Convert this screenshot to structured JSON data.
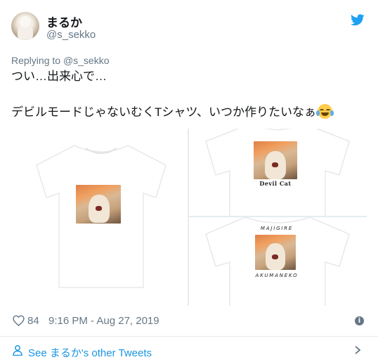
{
  "user": {
    "display_name": "まるか",
    "handle": "@s_sekko"
  },
  "reply": {
    "prefix": "Replying to",
    "mention": "@s_sekko"
  },
  "tweet": {
    "line1": "つい…出来心で…",
    "line2": "デビルモードじゃないむくTシャツ、いつか作りたいなぁ"
  },
  "media": {
    "caption_devil": "Devil Cat",
    "caption_top": "MAJIGIRE",
    "caption_bottom": "AKUMANEKO"
  },
  "stats": {
    "likes": "84",
    "timestamp": "9:16 PM - Aug 27, 2019"
  },
  "footer": {
    "see_more": "See まるか's other Tweets"
  },
  "colors": {
    "link": "#1b95e0",
    "muted": "#657786",
    "twitter_blue": "#1da1f2"
  },
  "icons": [
    "twitter-bird-icon",
    "laughing-crying-emoji",
    "heart-icon",
    "info-icon",
    "person-icon",
    "chevron-right-icon"
  ]
}
